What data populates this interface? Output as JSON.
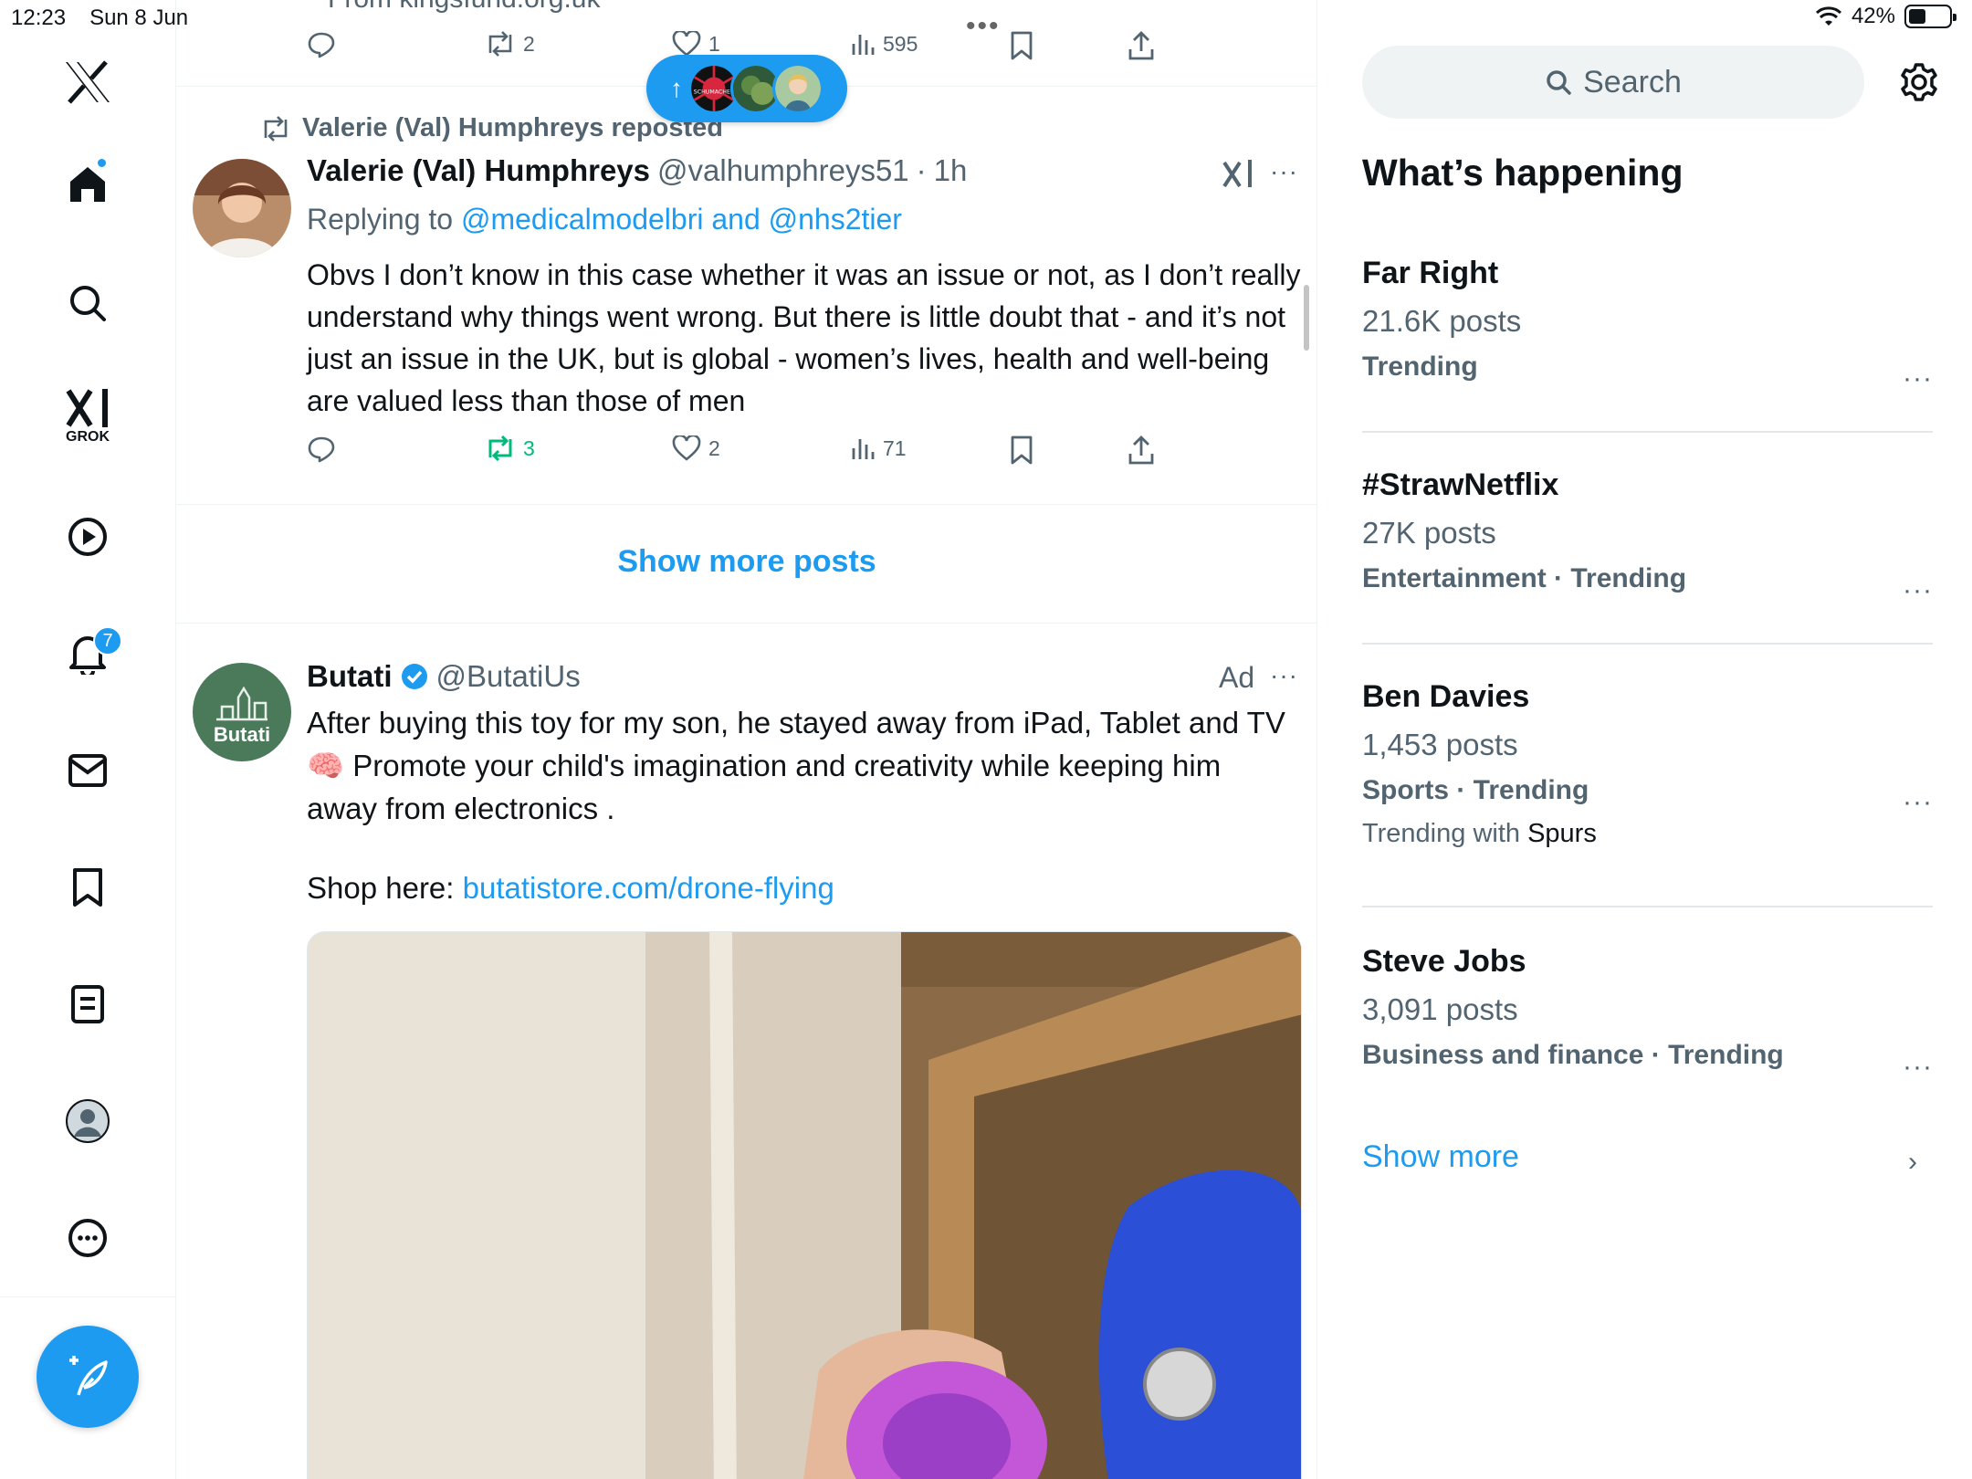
{
  "status_bar": {
    "time": "12:23",
    "date": "Sun 8 Jun",
    "battery": "42%",
    "battery_level": 0.42
  },
  "sidebar": {
    "grok_label": "GROK",
    "notifications_count": "7"
  },
  "feed": {
    "prev_post": {
      "source": "From kingsfund.org.uk",
      "reposts": "2",
      "likes": "1",
      "views": "595"
    },
    "new_posts_pill": {
      "arrow": "↑",
      "avatar_text": "SCHUMACHER"
    },
    "post": {
      "repost_label": "Valerie (Val) Humphreys reposted",
      "author_name": "Valerie (Val) Humphreys",
      "handle": "@valhumphreys51",
      "separator": "·",
      "time": "1h",
      "replying_prefix": "Replying to",
      "replying_to": "@medicalmodelbri and @nhs2tier",
      "text": "Obvs I don’t know in this case whether it was an issue or not, as I don’t really understand why things went wrong. But there is little doubt that - and it’s not just an issue in the UK, but is global - women’s lives, health and well-being are valued less than those of men",
      "reposts": "3",
      "likes": "2",
      "views": "71"
    },
    "show_more_posts": "Show more posts",
    "ad": {
      "author_name": "Butati",
      "avatar_text": "Butati",
      "handle": "@ButatiUs",
      "ad_label": "Ad",
      "text_1": "After buying this toy for my son, he stayed away from iPad, Tablet and TV 🧠 Promote your child's imagination and creativity while keeping him away from electronics .",
      "shop_prefix": "Shop here:",
      "shop_link": "butatistore.com/drone-flying"
    }
  },
  "right": {
    "search_placeholder": "Search",
    "heading": "What’s happening",
    "trends": [
      {
        "title": "Far Right",
        "count": "21.6K posts",
        "meta": "Trending"
      },
      {
        "title": "#StrawNetflix",
        "count": "27K posts",
        "meta": "Entertainment · Trending"
      },
      {
        "title": "Ben Davies",
        "count": "1,453 posts",
        "meta": "Sports · Trending",
        "with_prefix": "Trending with",
        "with_name": "Spurs"
      },
      {
        "title": "Steve Jobs",
        "count": "3,091 posts",
        "meta": "Business and finance · Trending"
      }
    ],
    "show_more": "Show more",
    "more_glyph": "···",
    "chevron": "›"
  },
  "colors": {
    "accent": "#1d9bf0",
    "repost_green": "#00ba7c",
    "text": "#0f1419",
    "muted": "#536471"
  }
}
